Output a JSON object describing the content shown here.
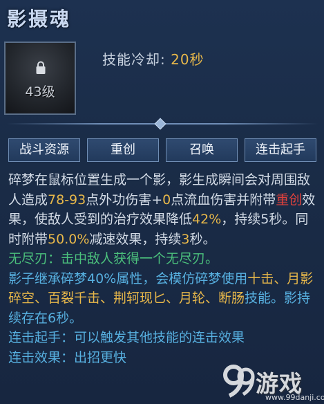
{
  "skill": {
    "name": "影摄魂",
    "level_req": "43级",
    "cooldown_label": "技能冷却:",
    "cooldown_value": "20秒"
  },
  "tags": [
    "战斗资源",
    "重创",
    "召唤",
    "连击起手"
  ],
  "description": [
    [
      {
        "t": "碎梦在鼠标位置生成一个影，影生成瞬间会对周围敌人造成"
      },
      {
        "t": "78-93",
        "c": "y"
      },
      {
        "t": "点外功伤害+"
      },
      {
        "t": "0",
        "c": "y"
      },
      {
        "t": "点流血伤害并附带"
      },
      {
        "t": "重创",
        "c": "r"
      },
      {
        "t": "效果，使敌人受到的治疗效果降低"
      },
      {
        "t": "42%",
        "c": "y"
      },
      {
        "t": "，持续5秒。同时附带"
      },
      {
        "t": "50.0%",
        "c": "y"
      },
      {
        "t": "减速效果，持续"
      },
      {
        "t": "3",
        "c": "y"
      },
      {
        "t": "秒。"
      }
    ],
    [
      {
        "t": "无尽刃：击中敌人获得一个无尽刃。",
        "c": "g"
      }
    ],
    [
      {
        "t": "影子继承碎梦40%属性，会模仿碎梦使用",
        "c": "b"
      },
      {
        "t": "十击、月影碎空、百裂千击、荆轲现匕、月轮、断肠",
        "c": "y"
      },
      {
        "t": "技能。影持续存在6秒。",
        "c": "b"
      }
    ],
    [
      {
        "t": "连击起手：可以触发其他技能的连击效果",
        "c": "b"
      }
    ],
    [
      {
        "t": "连击效果：出招更快",
        "c": "b"
      }
    ]
  ],
  "watermark": {
    "text": "游戏",
    "site": "www.99danji.com"
  },
  "colors": {
    "value_yellow": "#e8b84a",
    "heavy_red": "#e0413c",
    "passive_green": "#4bc07c",
    "info_blue": "#57b0e0"
  }
}
